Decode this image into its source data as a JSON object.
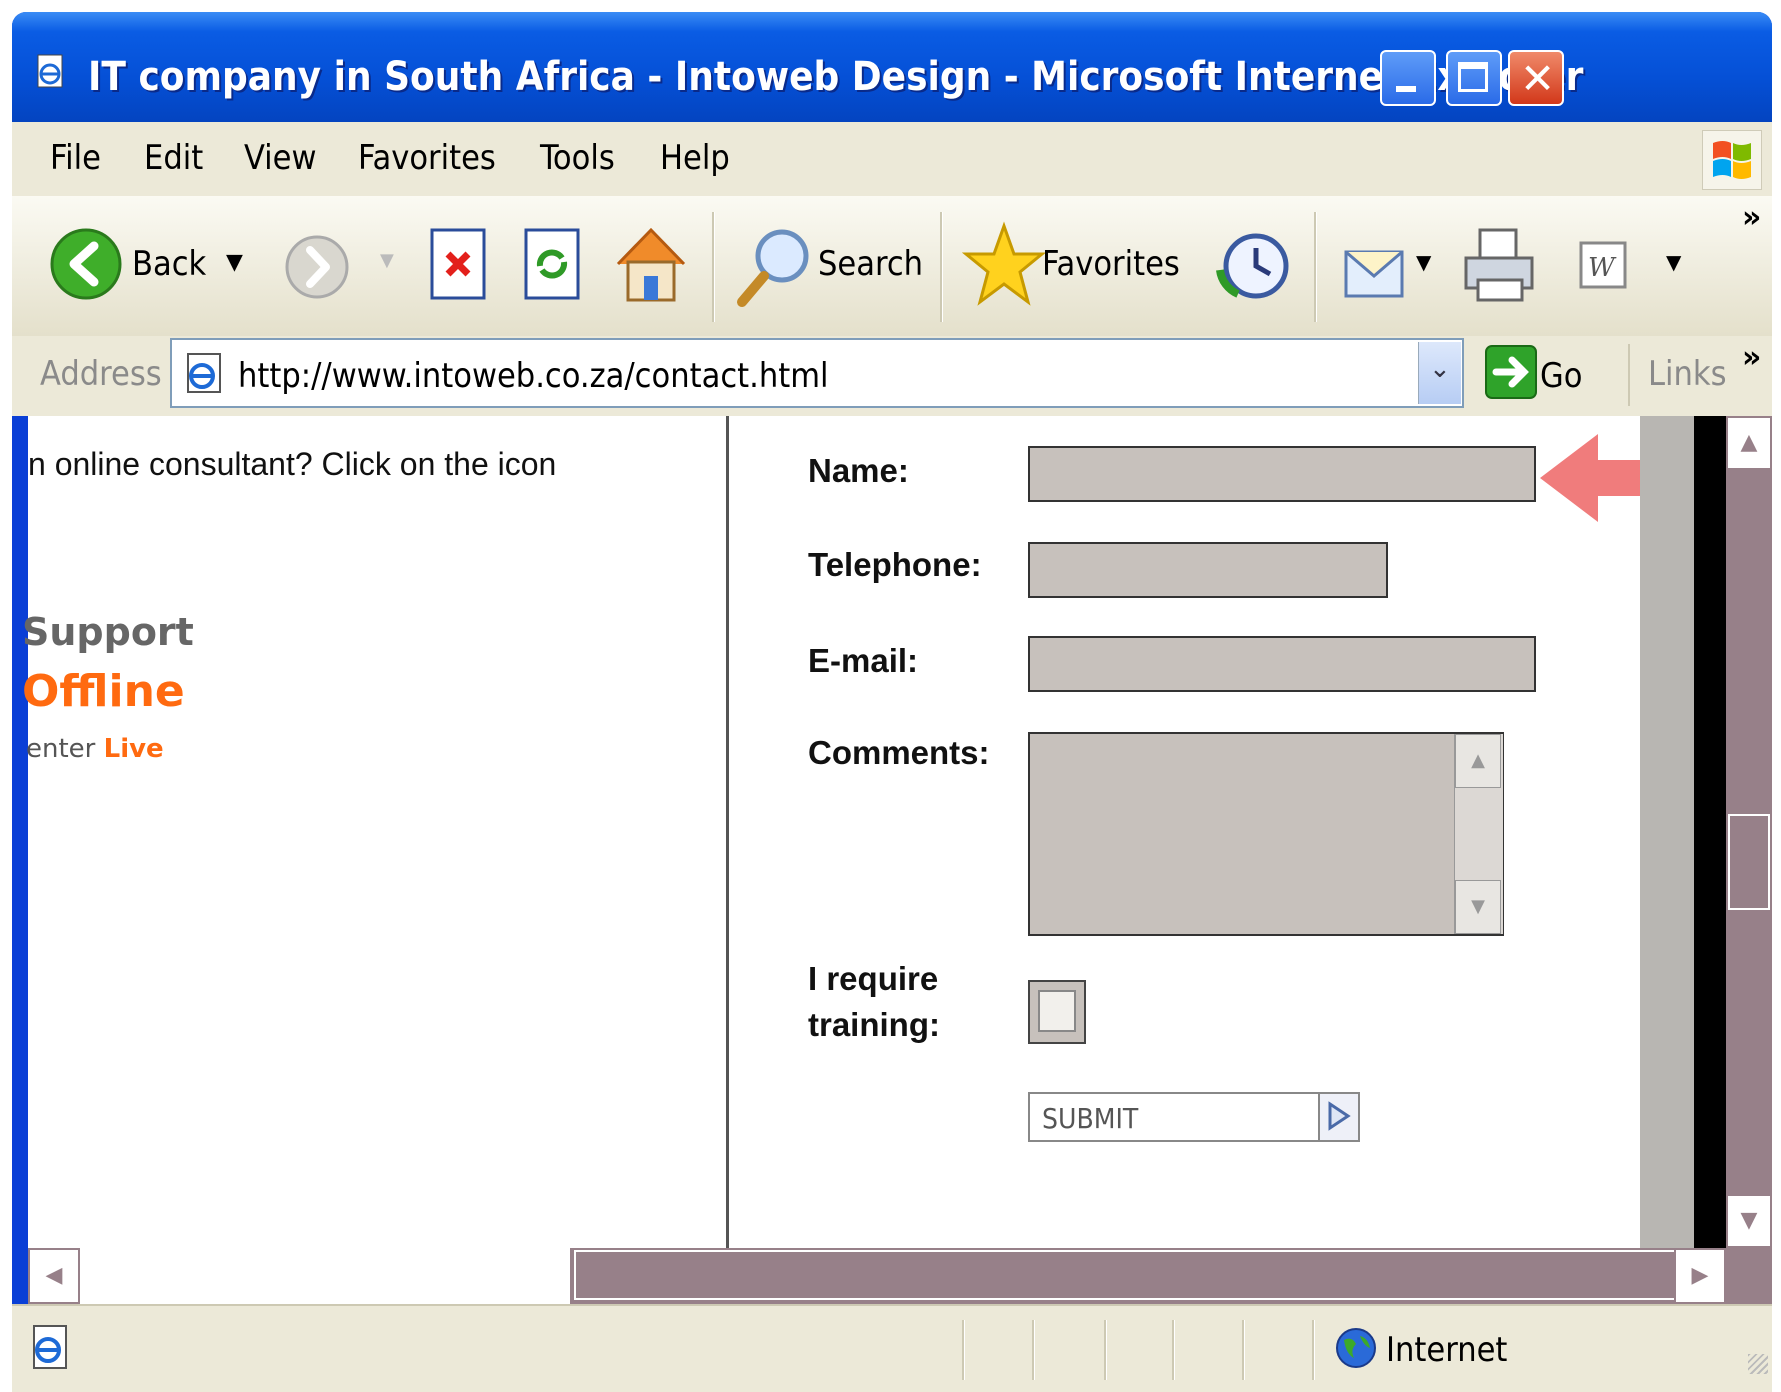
{
  "window": {
    "title": "IT company in South Africa - Intoweb Design - Microsoft Internet Explorer"
  },
  "menu": [
    "File",
    "Edit",
    "View",
    "Favorites",
    "Tools",
    "Help"
  ],
  "toolbar": {
    "back_label": "Back",
    "search_label": "Search",
    "favorites_label": "Favorites",
    "overflow": "»"
  },
  "address": {
    "label": "Address",
    "url": "http://www.intoweb.co.za/contact.html",
    "go_label": "Go",
    "links_label": "Links",
    "overflow": "»"
  },
  "left_panel": {
    "consultant_text": "n online consultant? Click on the icon",
    "support_text": "Support",
    "status_text": "Offline",
    "brand_part1": "enter ",
    "brand_part2": "Live"
  },
  "form": {
    "name_label": "Name:",
    "telephone_label": "Telephone:",
    "email_label": "E-mail:",
    "comments_label": "Comments:",
    "training_label_line1": "I require",
    "training_label_line2": "training:",
    "submit_label": "SUBMIT",
    "name_value": "",
    "telephone_value": "",
    "email_value": "",
    "comments_value": "",
    "training_checked": false
  },
  "statusbar": {
    "zone": "Internet"
  },
  "colors": {
    "title_blue": "#0550d6",
    "input_fill": "#c7c1bc",
    "scrollbar": "#978089",
    "accent_orange": "#ff6a10",
    "arrow_pink": "#f07c7c"
  }
}
